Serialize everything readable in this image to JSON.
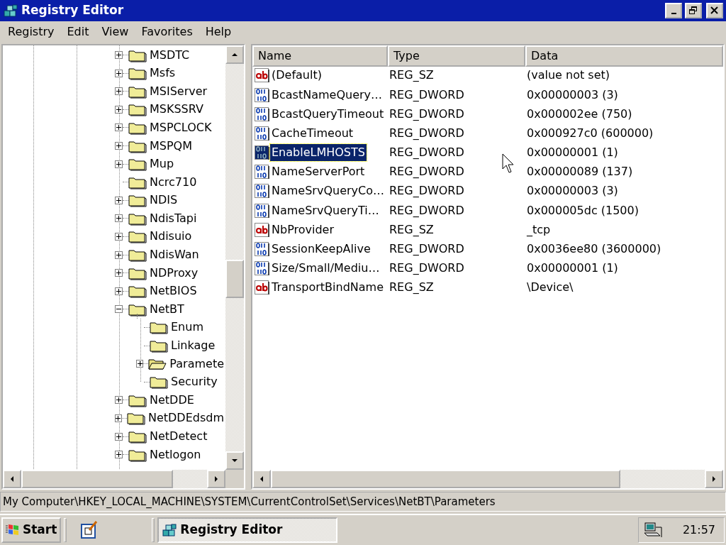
{
  "window": {
    "title": "Registry Editor"
  },
  "menu": [
    "Registry",
    "Edit",
    "View",
    "Favorites",
    "Help"
  ],
  "tree": [
    {
      "label": "MSDTC",
      "expandable": true,
      "expanded": false,
      "selected": false
    },
    {
      "label": "Msfs",
      "expandable": true,
      "expanded": false,
      "selected": false
    },
    {
      "label": "MSIServer",
      "expandable": true,
      "expanded": false,
      "selected": false
    },
    {
      "label": "MSKSSRV",
      "expandable": true,
      "expanded": false,
      "selected": false
    },
    {
      "label": "MSPCLOCK",
      "expandable": true,
      "expanded": false,
      "selected": false
    },
    {
      "label": "MSPQM",
      "expandable": true,
      "expanded": false,
      "selected": false
    },
    {
      "label": "Mup",
      "expandable": true,
      "expanded": false,
      "selected": false
    },
    {
      "label": "Ncrc710",
      "expandable": false,
      "expanded": false,
      "selected": false
    },
    {
      "label": "NDIS",
      "expandable": true,
      "expanded": false,
      "selected": false
    },
    {
      "label": "NdisTapi",
      "expandable": true,
      "expanded": false,
      "selected": false
    },
    {
      "label": "Ndisuio",
      "expandable": true,
      "expanded": false,
      "selected": false
    },
    {
      "label": "NdisWan",
      "expandable": true,
      "expanded": false,
      "selected": false
    },
    {
      "label": "NDProxy",
      "expandable": true,
      "expanded": false,
      "selected": false
    },
    {
      "label": "NetBIOS",
      "expandable": true,
      "expanded": false,
      "selected": false
    },
    {
      "label": "NetBT",
      "expandable": true,
      "expanded": true,
      "selected": false,
      "children": [
        {
          "label": "Enum",
          "expandable": false,
          "expanded": false,
          "selected": false
        },
        {
          "label": "Linkage",
          "expandable": false,
          "expanded": false,
          "selected": false
        },
        {
          "label": "Paramete",
          "expandable": true,
          "expanded": false,
          "selected": true
        },
        {
          "label": "Security",
          "expandable": false,
          "expanded": false,
          "selected": false
        }
      ]
    },
    {
      "label": "NetDDE",
      "expandable": true,
      "expanded": false,
      "selected": false
    },
    {
      "label": "NetDDEdsdm",
      "expandable": true,
      "expanded": false,
      "selected": false
    },
    {
      "label": "NetDetect",
      "expandable": true,
      "expanded": false,
      "selected": false
    },
    {
      "label": "Netlogon",
      "expandable": true,
      "expanded": false,
      "selected": false
    }
  ],
  "values": {
    "columns": [
      "Name",
      "Type",
      "Data"
    ],
    "rows": [
      {
        "kind": "string",
        "name": "(Default)",
        "type": "REG_SZ",
        "data": "(value not set)",
        "selected": false
      },
      {
        "kind": "dword",
        "name": "BcastNameQuery…",
        "type": "REG_DWORD",
        "data": "0x00000003 (3)",
        "selected": false
      },
      {
        "kind": "dword",
        "name": "BcastQueryTimeout",
        "type": "REG_DWORD",
        "data": "0x000002ee (750)",
        "selected": false
      },
      {
        "kind": "dword",
        "name": "CacheTimeout",
        "type": "REG_DWORD",
        "data": "0x000927c0 (600000)",
        "selected": false
      },
      {
        "kind": "dword",
        "name": "EnableLMHOSTS",
        "type": "REG_DWORD",
        "data": "0x00000001 (1)",
        "selected": true
      },
      {
        "kind": "dword",
        "name": "NameServerPort",
        "type": "REG_DWORD",
        "data": "0x00000089 (137)",
        "selected": false
      },
      {
        "kind": "dword",
        "name": "NameSrvQueryCo…",
        "type": "REG_DWORD",
        "data": "0x00000003 (3)",
        "selected": false
      },
      {
        "kind": "dword",
        "name": "NameSrvQueryTi…",
        "type": "REG_DWORD",
        "data": "0x000005dc (1500)",
        "selected": false
      },
      {
        "kind": "string",
        "name": "NbProvider",
        "type": "REG_SZ",
        "data": "_tcp",
        "selected": false
      },
      {
        "kind": "dword",
        "name": "SessionKeepAlive",
        "type": "REG_DWORD",
        "data": "0x0036ee80 (3600000)",
        "selected": false
      },
      {
        "kind": "dword",
        "name": "Size/Small/Mediu…",
        "type": "REG_DWORD",
        "data": "0x00000001 (1)",
        "selected": false
      },
      {
        "kind": "string",
        "name": "TransportBindName",
        "type": "REG_SZ",
        "data": "\\Device\\",
        "selected": false
      }
    ]
  },
  "status_bar": "My Computer\\HKEY_LOCAL_MACHINE\\SYSTEM\\CurrentControlSet\\Services\\NetBT\\Parameters",
  "taskbar": {
    "start": "Start",
    "tasks": [
      {
        "label": "Registry Editor",
        "selected": true
      }
    ],
    "clock": "21:57"
  }
}
